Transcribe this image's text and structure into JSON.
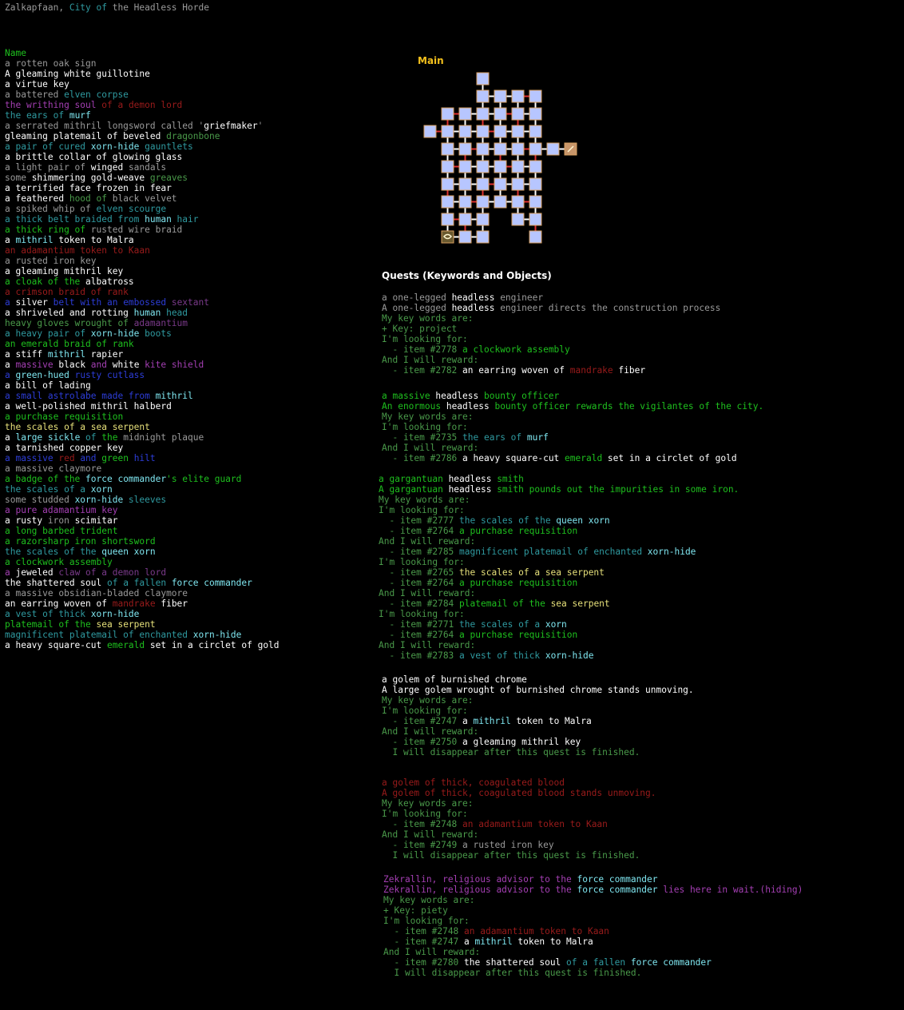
{
  "title": [
    [
      "Zalkapfaan, ",
      "gr"
    ],
    [
      "City of ",
      "dc"
    ],
    [
      "the Headless Horde",
      "gr"
    ]
  ],
  "items_header": [
    [
      "Name",
      "g"
    ]
  ],
  "items": [
    [
      [
        "a rotten oak sign",
        "gr"
      ]
    ],
    [
      [
        "A gleaming white guillotine",
        "w"
      ]
    ],
    [
      [
        "a virtue key",
        "w"
      ]
    ],
    [
      [
        "a battered ",
        "gr"
      ],
      [
        "elven corpse",
        "dc"
      ]
    ],
    [
      [
        "the writhing soul ",
        "p"
      ],
      [
        "of a ",
        "r"
      ],
      [
        "demon lord",
        "r"
      ]
    ],
    [
      [
        "the ears of ",
        "dc"
      ],
      [
        "murf",
        "c"
      ]
    ],
    [
      [
        "a serrated mithril longsword called '",
        "gr"
      ],
      [
        "griefmaker",
        "w"
      ],
      [
        "'",
        "gr"
      ]
    ],
    [
      [
        "gleaming platemail of beveled ",
        "w"
      ],
      [
        "dragonbone",
        "dg"
      ]
    ],
    [
      [
        "a pair of cured ",
        "dc"
      ],
      [
        "xorn-hide",
        "c"
      ],
      [
        " gauntlets",
        "dc"
      ]
    ],
    [
      [
        "a brittle collar of glowing glass",
        "w"
      ]
    ],
    [
      [
        "a light pair of ",
        "gr"
      ],
      [
        "winged",
        "w"
      ],
      [
        " sandals",
        "gr"
      ]
    ],
    [
      [
        "some ",
        "gr"
      ],
      [
        "shimmering gold-weave",
        "w"
      ],
      [
        " greaves",
        "dg"
      ]
    ],
    [
      [
        "a terrified face frozen in fear",
        "w"
      ]
    ],
    [
      [
        "a feathered ",
        "w"
      ],
      [
        "hood of ",
        "dg"
      ],
      [
        "black velvet",
        "gr"
      ]
    ],
    [
      [
        "a spiked whip of ",
        "gr"
      ],
      [
        "elven scourge",
        "dc"
      ]
    ],
    [
      [
        "a thick belt braided from ",
        "dc"
      ],
      [
        "human",
        "c"
      ],
      [
        " hair",
        "dc"
      ]
    ],
    [
      [
        "a thick ring of ",
        "g"
      ],
      [
        "rusted wire braid",
        "gr"
      ]
    ],
    [
      [
        "a ",
        "w"
      ],
      [
        "mithril",
        "c"
      ],
      [
        " token to Malra",
        "w"
      ]
    ],
    [
      [
        "an adamantium token to Kaan",
        "r"
      ]
    ],
    [
      [
        "a rusted iron key",
        "gr"
      ]
    ],
    [
      [
        "a gleaming mithril key",
        "w"
      ]
    ],
    [
      [
        "a cloak of the ",
        "g"
      ],
      [
        "albatross",
        "w"
      ]
    ],
    [
      [
        "a crimson braid of rank",
        "r"
      ]
    ],
    [
      [
        "a ",
        "b"
      ],
      [
        "silver ",
        "w"
      ],
      [
        "belt with an embossed ",
        "b"
      ],
      [
        "sextant",
        "dp"
      ]
    ],
    [
      [
        "a shriveled and rotting ",
        "w"
      ],
      [
        "human",
        "c"
      ],
      [
        " head",
        "dc"
      ]
    ],
    [
      [
        "heavy gloves wrought of ",
        "dg"
      ],
      [
        "adamantium",
        "dp"
      ]
    ],
    [
      [
        "a heavy pair of ",
        "dc"
      ],
      [
        "xorn-hide",
        "c"
      ],
      [
        " boots",
        "dc"
      ]
    ],
    [
      [
        "an emerald braid of rank",
        "g"
      ]
    ],
    [
      [
        "a stiff ",
        "w"
      ],
      [
        "mithril",
        "c"
      ],
      [
        " rapier",
        "w"
      ]
    ],
    [
      [
        "a ",
        "w"
      ],
      [
        "massive ",
        "p"
      ],
      [
        "black ",
        "w"
      ],
      [
        "and ",
        "p"
      ],
      [
        "white ",
        "w"
      ],
      [
        "kite shield",
        "p"
      ]
    ],
    [
      [
        "a ",
        "b"
      ],
      [
        "green-hued ",
        "c"
      ],
      [
        "rusty ",
        "b"
      ],
      [
        "cutlass",
        "b"
      ]
    ],
    [
      [
        "a bill of lading",
        "w"
      ]
    ],
    [
      [
        "a small astrolabe made from ",
        "b"
      ],
      [
        "mithril",
        "c"
      ]
    ],
    [
      [
        "a well-polished mithril halberd",
        "w"
      ]
    ],
    [
      [
        "a purchase requisition",
        "g"
      ]
    ],
    [
      [
        "the scales of a sea serpent",
        "y"
      ]
    ],
    [
      [
        "a ",
        "w"
      ],
      [
        "large sickle ",
        "c"
      ],
      [
        "of ",
        "dc"
      ],
      [
        "the ",
        "g"
      ],
      [
        "midnight plaque",
        "gr"
      ]
    ],
    [
      [
        "a tarnished copper key",
        "w"
      ]
    ],
    [
      [
        "a massive ",
        "b"
      ],
      [
        "red ",
        "r"
      ],
      [
        "and ",
        "b"
      ],
      [
        "green ",
        "g"
      ],
      [
        "hilt",
        "b"
      ]
    ],
    [
      [
        "a massive claymore",
        "gr"
      ]
    ],
    [
      [
        "a badge of the ",
        "g"
      ],
      [
        "force commander",
        "c"
      ],
      [
        "'s elite guard",
        "g"
      ]
    ],
    [
      [
        "the scales of a ",
        "dc"
      ],
      [
        "xorn",
        "c"
      ]
    ],
    [
      [
        "some studded ",
        "gr"
      ],
      [
        "xorn-hide",
        "c"
      ],
      [
        " sleeves",
        "dc"
      ]
    ],
    [
      [
        "a pure adamantium key",
        "p"
      ]
    ],
    [
      [
        "a rusty ",
        "w"
      ],
      [
        "iron",
        "gr"
      ],
      [
        " scimitar",
        "w"
      ]
    ],
    [
      [
        "a long barbed trident",
        "g"
      ]
    ],
    [
      [
        "a razorsharp iron shortsword",
        "g"
      ]
    ],
    [
      [
        "the scales of the ",
        "dc"
      ],
      [
        "queen xorn",
        "c"
      ]
    ],
    [
      [
        "a clockwork assembly",
        "g"
      ]
    ],
    [
      [
        "a ",
        "p"
      ],
      [
        "jeweled ",
        "w"
      ],
      [
        "claw of a demon lord",
        "dp"
      ]
    ],
    [
      [
        "the shattered soul ",
        "w"
      ],
      [
        "of a fallen ",
        "dc"
      ],
      [
        "force commander",
        "c"
      ]
    ],
    [
      [
        "a massive obsidian-bladed claymore",
        "gr"
      ]
    ],
    [
      [
        "an earring woven of ",
        "w"
      ],
      [
        "mandrake",
        "r"
      ],
      [
        " fiber",
        "w"
      ]
    ],
    [
      [
        "a vest of thick ",
        "dc"
      ],
      [
        "xorn-hide",
        "c"
      ]
    ],
    [
      [
        "platemail of the ",
        "g"
      ],
      [
        "sea serpent",
        "y"
      ]
    ],
    [
      [
        "magnificent platemail of enchanted ",
        "dc"
      ],
      [
        "xorn-hide",
        "c"
      ]
    ],
    [
      [
        "a heavy square-cut ",
        "w"
      ],
      [
        "emerald",
        "g"
      ],
      [
        " set in a circlet of gold",
        "w"
      ]
    ]
  ],
  "map_label": "Main",
  "quests_title": "Quests (Keywords and Objects)",
  "quest_blocks": [
    {
      "lines": [
        [
          [
            "a one-legged ",
            "gr"
          ],
          [
            "headless",
            "w"
          ],
          [
            " engineer",
            "gr"
          ]
        ],
        [
          [
            "A one-legged ",
            "gr"
          ],
          [
            "headless",
            "w"
          ],
          [
            " engineer directs the construction process",
            "gr"
          ]
        ],
        [
          [
            "My key words are:",
            "dg"
          ]
        ],
        [
          [
            "+ Key: project",
            "dg"
          ]
        ],
        [
          [
            "I'm looking for:",
            "dg"
          ]
        ],
        [
          [
            "  - item #2778 ",
            "dg"
          ],
          [
            "a clockwork assembly",
            "g"
          ]
        ],
        [
          [
            "And I will reward:",
            "dg"
          ]
        ],
        [
          [
            "  - item #2782 ",
            "dg"
          ],
          [
            "an earring woven of ",
            "w"
          ],
          [
            "mandrake",
            "r"
          ],
          [
            " fiber",
            "w"
          ]
        ]
      ]
    },
    {
      "lines": [
        [
          [
            "a massive ",
            "g"
          ],
          [
            "headless",
            "w"
          ],
          [
            " bounty officer",
            "g"
          ]
        ],
        [
          [
            "An enormous ",
            "g"
          ],
          [
            "headless",
            "w"
          ],
          [
            " bounty officer rewards the vigilantes of the city.",
            "g"
          ]
        ],
        [
          [
            "My key words are:",
            "dg"
          ]
        ],
        [
          [
            "I'm looking for:",
            "dg"
          ]
        ],
        [
          [
            "  - item #2735 ",
            "dg"
          ],
          [
            "the ears of ",
            "dc"
          ],
          [
            "murf",
            "c"
          ]
        ],
        [
          [
            "And I will reward:",
            "dg"
          ]
        ],
        [
          [
            "  - item #2786 ",
            "dg"
          ],
          [
            "a heavy square-cut ",
            "w"
          ],
          [
            "emerald",
            "g"
          ],
          [
            " set in a circlet of gold",
            "w"
          ]
        ]
      ]
    },
    {
      "lines": [
        [
          [
            "a gargantuan ",
            "g"
          ],
          [
            "headless",
            "w"
          ],
          [
            " smith",
            "g"
          ]
        ],
        [
          [
            "A gargantuan ",
            "g"
          ],
          [
            "headless",
            "w"
          ],
          [
            " smith pounds out the impurities in some iron.",
            "g"
          ]
        ],
        [
          [
            "My key words are:",
            "dg"
          ]
        ],
        [
          [
            "I'm looking for:",
            "dg"
          ]
        ],
        [
          [
            "  - item #2777 ",
            "dg"
          ],
          [
            "the scales of the ",
            "dc"
          ],
          [
            "queen xorn",
            "c"
          ]
        ],
        [
          [
            "  - item #2764 ",
            "dg"
          ],
          [
            "a purchase requisition",
            "g"
          ]
        ],
        [
          [
            "And I will reward:",
            "dg"
          ]
        ],
        [
          [
            "  - item #2785 ",
            "dg"
          ],
          [
            "magnificent platemail of enchanted ",
            "dc"
          ],
          [
            "xorn-hide",
            "c"
          ]
        ],
        [
          [
            "I'm looking for:",
            "dg"
          ]
        ],
        [
          [
            "  - item #2765 ",
            "dg"
          ],
          [
            "the scales of a sea serpent",
            "y"
          ]
        ],
        [
          [
            "  - item #2764 ",
            "dg"
          ],
          [
            "a purchase requisition",
            "g"
          ]
        ],
        [
          [
            "And I will reward:",
            "dg"
          ]
        ],
        [
          [
            "  - item #2784 ",
            "dg"
          ],
          [
            "platemail of the ",
            "g"
          ],
          [
            "sea serpent",
            "y"
          ]
        ],
        [
          [
            "I'm looking for:",
            "dg"
          ]
        ],
        [
          [
            "  - item #2771 ",
            "dg"
          ],
          [
            "the scales of a ",
            "dc"
          ],
          [
            "xorn",
            "c"
          ]
        ],
        [
          [
            "  - item #2764 ",
            "dg"
          ],
          [
            "a purchase requisition",
            "g"
          ]
        ],
        [
          [
            "And I will reward:",
            "dg"
          ]
        ],
        [
          [
            "  - item #2783 ",
            "dg"
          ],
          [
            "a vest of thick ",
            "dc"
          ],
          [
            "xorn-hide",
            "c"
          ]
        ]
      ]
    },
    {
      "lines": [
        [
          [
            "a golem of burnished chrome",
            "w"
          ]
        ],
        [
          [
            "A large golem wrought of burnished chrome stands unmoving.",
            "w"
          ]
        ],
        [
          [
            "My key words are:",
            "dg"
          ]
        ],
        [
          [
            "I'm looking for:",
            "dg"
          ]
        ],
        [
          [
            "  - item #2747 ",
            "dg"
          ],
          [
            "a ",
            "w"
          ],
          [
            "mithril",
            "c"
          ],
          [
            " token to Malra",
            "w"
          ]
        ],
        [
          [
            "And I will reward:",
            "dg"
          ]
        ],
        [
          [
            "  - item #2750 ",
            "dg"
          ],
          [
            "a gleaming mithril key",
            "w"
          ]
        ],
        [
          [
            "  I will disappear after this quest is finished.",
            "dg"
          ]
        ]
      ]
    },
    {
      "lines": [
        [
          [
            "a golem of thick, coagulated blood",
            "r"
          ]
        ],
        [
          [
            "A golem of thick, coagulated blood stands unmoving.",
            "r"
          ]
        ],
        [
          [
            "My key words are:",
            "dg"
          ]
        ],
        [
          [
            "I'm looking for:",
            "dg"
          ]
        ],
        [
          [
            "  - item #2748 ",
            "dg"
          ],
          [
            "an adamantium token to Kaan",
            "r"
          ]
        ],
        [
          [
            "And I will reward:",
            "dg"
          ]
        ],
        [
          [
            "  - item #2749 ",
            "dg"
          ],
          [
            "a rusted iron key",
            "gr"
          ]
        ],
        [
          [
            "  I will disappear after this quest is finished.",
            "dg"
          ]
        ]
      ]
    },
    {
      "lines": [
        [
          [
            "Zekrallin, religious advisor to the ",
            "p"
          ],
          [
            "force commander",
            "c"
          ]
        ],
        [
          [
            "Zekrallin, religious advisor to the ",
            "p"
          ],
          [
            "force commander",
            "c"
          ],
          [
            " lies here in wait.(hiding)",
            "p"
          ]
        ],
        [
          [
            "My key words are:",
            "dg"
          ]
        ],
        [
          [
            "+ Key: piety",
            "dg"
          ]
        ],
        [
          [
            "I'm looking for:",
            "dg"
          ]
        ],
        [
          [
            "  - item #2748 ",
            "dg"
          ],
          [
            "an adamantium token to Kaan",
            "r"
          ]
        ],
        [
          [
            "  - item #2747 ",
            "dg"
          ],
          [
            "a ",
            "w"
          ],
          [
            "mithril",
            "c"
          ],
          [
            " token to Malra",
            "w"
          ]
        ],
        [
          [
            "And I will reward:",
            "dg"
          ]
        ],
        [
          [
            "  - item #2780 ",
            "dg"
          ],
          [
            "the shattered soul ",
            "w"
          ],
          [
            "of a fallen ",
            "dc"
          ],
          [
            "force commander",
            "c"
          ]
        ],
        [
          [
            "  I will disappear after this quest is finished.",
            "dg"
          ]
        ]
      ]
    }
  ],
  "map": {
    "rooms": [
      [
        3,
        0
      ],
      [
        3,
        1
      ],
      [
        4,
        1
      ],
      [
        5,
        1
      ],
      [
        6,
        1
      ],
      [
        1,
        2
      ],
      [
        2,
        2
      ],
      [
        3,
        2
      ],
      [
        4,
        2
      ],
      [
        5,
        2
      ],
      [
        6,
        2
      ],
      [
        0,
        3
      ],
      [
        1,
        3
      ],
      [
        2,
        3
      ],
      [
        3,
        3
      ],
      [
        4,
        3
      ],
      [
        5,
        3
      ],
      [
        6,
        3
      ],
      [
        1,
        4
      ],
      [
        2,
        4
      ],
      [
        3,
        4
      ],
      [
        4,
        4
      ],
      [
        5,
        4
      ],
      [
        6,
        4
      ],
      [
        7,
        4
      ],
      [
        1,
        5
      ],
      [
        2,
        5
      ],
      [
        3,
        5
      ],
      [
        4,
        5
      ],
      [
        5,
        5
      ],
      [
        6,
        5
      ],
      [
        1,
        6
      ],
      [
        2,
        6
      ],
      [
        3,
        6
      ],
      [
        4,
        6
      ],
      [
        5,
        6
      ],
      [
        6,
        6
      ],
      [
        1,
        7
      ],
      [
        2,
        7
      ],
      [
        3,
        7
      ],
      [
        4,
        7
      ],
      [
        5,
        7
      ],
      [
        6,
        7
      ],
      [
        1,
        8
      ],
      [
        2,
        8
      ],
      [
        3,
        8
      ],
      [
        5,
        8
      ],
      [
        6,
        8
      ],
      [
        2,
        9
      ],
      [
        3,
        9
      ],
      [
        6,
        9
      ]
    ],
    "special_rooms": [
      {
        "col": 8,
        "row": 4,
        "icon": "shop-icon"
      },
      {
        "col": 1,
        "row": 9,
        "icon": "entrance-icon"
      }
    ],
    "colors": {
      "room": "#b7c6ff",
      "border": "#d8a060",
      "door": "#e03030",
      "special": "#c8966a"
    }
  }
}
